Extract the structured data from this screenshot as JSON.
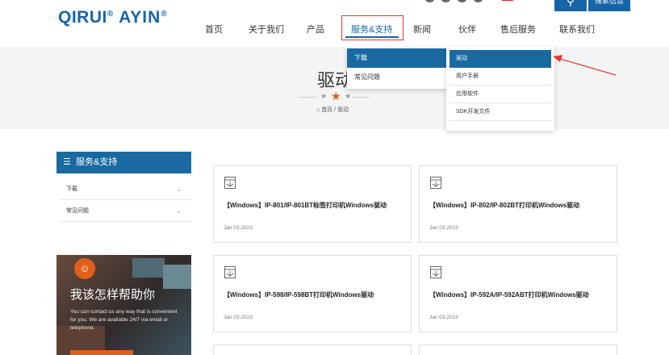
{
  "header": {
    "logo_main": "QIRUI",
    "logo_sub": "AYIN",
    "logo_reg": "®",
    "search_label": "搜索信息",
    "nav": [
      "首页",
      "关于我们",
      "产品",
      "服务&支持",
      "新闻",
      "伙伴",
      "售后服务",
      "联系我们"
    ],
    "active_nav_index": 3
  },
  "banner": {
    "title": "驱动",
    "crumb_home": "首页",
    "crumb_sep": "/",
    "crumb_current": "驱动"
  },
  "dropdown": {
    "level1": [
      "下载",
      "常见问题"
    ],
    "level2": [
      "驱动",
      "用户手册",
      "应用软件",
      "SDK开发文件"
    ]
  },
  "sidebar": {
    "title": "服务&支持",
    "items": [
      "下载",
      "常见问题"
    ],
    "help_title": "我该怎样帮助你",
    "help_text": "You can contact us any way that is convenient for you. We are available 24/7 via email or telephone."
  },
  "cards": [
    {
      "title": "【Windows】IP-801/IP-801BT标签打印机Windows驱动",
      "date": "Jan 03.2023"
    },
    {
      "title": "【Windows】IP-802/IP-802BT打印机Windows驱动",
      "date": "Jan 03.2023"
    },
    {
      "title": "【Windows】IP-598/IP-598BT打印机Windows驱动",
      "date": "Jan 03.2023"
    },
    {
      "title": "【Windows】IP-592A/IP-592ABT打印机Windows驱动",
      "date": "Jan 03.2023"
    }
  ],
  "colors": {
    "brand_blue": "#1a6aa1",
    "accent_orange": "#e0601b",
    "highlight_red": "#e53935"
  }
}
